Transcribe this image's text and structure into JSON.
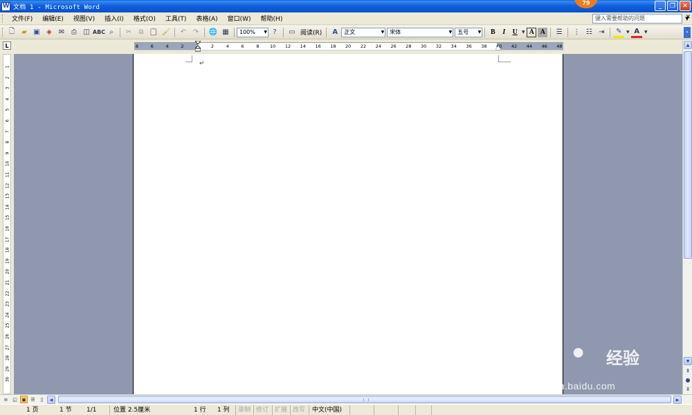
{
  "window": {
    "title": "文档 1 - Microsoft Word",
    "badge": "79"
  },
  "menu": {
    "items": [
      {
        "label": "文件(F)"
      },
      {
        "label": "编辑(E)"
      },
      {
        "label": "视图(V)"
      },
      {
        "label": "插入(I)"
      },
      {
        "label": "格式(O)"
      },
      {
        "label": "工具(T)"
      },
      {
        "label": "表格(A)"
      },
      {
        "label": "窗口(W)"
      },
      {
        "label": "帮助(H)"
      }
    ],
    "help_placeholder": "键入需要帮助的问题"
  },
  "toolbar": {
    "zoom": "100%",
    "read_label": "阅读(R)",
    "style": "正文",
    "font": "宋体",
    "size": "五号",
    "bold": "B",
    "italic": "I",
    "underline": "U"
  },
  "ruler": {
    "tab_selector": "L",
    "h_numbers": [
      "8",
      "6",
      "4",
      "2",
      "2",
      "4",
      "6",
      "8",
      "10",
      "12",
      "14",
      "16",
      "18",
      "20",
      "22",
      "24",
      "26",
      "28",
      "30",
      "32",
      "34",
      "36",
      "38",
      "40",
      "42",
      "44",
      "46",
      "48"
    ],
    "v_numbers": [
      "1",
      "2",
      "3",
      "4",
      "5",
      "6",
      "7",
      "8",
      "9",
      "10",
      "11",
      "12",
      "13",
      "14",
      "15",
      "16",
      "17",
      "18",
      "19",
      "20",
      "21",
      "22",
      "23",
      "24",
      "25",
      "26",
      "27",
      "28",
      "29",
      "30"
    ]
  },
  "document": {
    "paragraph_mark": "↵"
  },
  "status": {
    "page": "1 页",
    "section": "1 节",
    "page_of": "1/1",
    "position": "位置 2.5厘米",
    "line": "1 行",
    "column": "1 列",
    "rec": "录制",
    "trk": "修订",
    "ext": "扩展",
    "ovr": "改写",
    "language": "中文(中国)"
  },
  "watermark": {
    "brand": "Bai",
    "brand2": "经验",
    "url": "jingyan.baidu.com"
  },
  "colors": {
    "titlebar": "#0a50c8",
    "workspace": "#8f98ae",
    "chrome": "#ece9d8",
    "font_color_accent": "#e02020",
    "highlight_accent": "#f5e400"
  }
}
